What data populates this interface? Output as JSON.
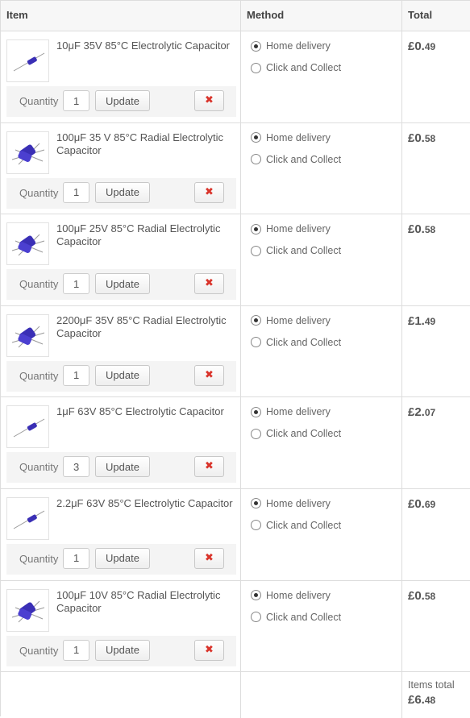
{
  "header": {
    "item": "Item",
    "method": "Method",
    "total": "Total"
  },
  "labels": {
    "quantity": "Quantity",
    "update": "Update",
    "remove": "✖",
    "home_delivery": "Home delivery",
    "click_collect": "Click and Collect"
  },
  "rows": [
    {
      "name": "10μF 35V 85°C Electrolytic Capacitor",
      "qty": "1",
      "method": "home",
      "price_major": "£0.",
      "price_minor": "49",
      "thumb": "axial"
    },
    {
      "name": "100μF 35 V 85°C Radial Electrolytic Capacitor",
      "qty": "1",
      "method": "home",
      "price_major": "£0.",
      "price_minor": "58",
      "thumb": "radial"
    },
    {
      "name": "100μF 25V 85°C Radial Electrolytic Capacitor",
      "qty": "1",
      "method": "home",
      "price_major": "£0.",
      "price_minor": "58",
      "thumb": "radial"
    },
    {
      "name": "2200μF 35V 85°C Radial Electrolytic Capacitor",
      "qty": "1",
      "method": "home",
      "price_major": "£1.",
      "price_minor": "49",
      "thumb": "radial"
    },
    {
      "name": "1μF 63V 85°C Electrolytic Capacitor",
      "qty": "3",
      "method": "home",
      "price_major": "£2.",
      "price_minor": "07",
      "thumb": "axial"
    },
    {
      "name": "2.2μF 63V 85°C Electrolytic Capacitor",
      "qty": "1",
      "method": "home",
      "price_major": "£0.",
      "price_minor": "69",
      "thumb": "axial"
    },
    {
      "name": "100μF 10V 85°C Radial Electrolytic Capacitor",
      "qty": "1",
      "method": "home",
      "price_major": "£0.",
      "price_minor": "58",
      "thumb": "radial"
    }
  ],
  "footer": {
    "items_total_label": "Items total",
    "total_major": "£6.",
    "total_minor": "48"
  },
  "colors": {
    "remove": "#d9342b",
    "capacitor_blue": "#3a2fb5",
    "border": "#dddddd"
  }
}
